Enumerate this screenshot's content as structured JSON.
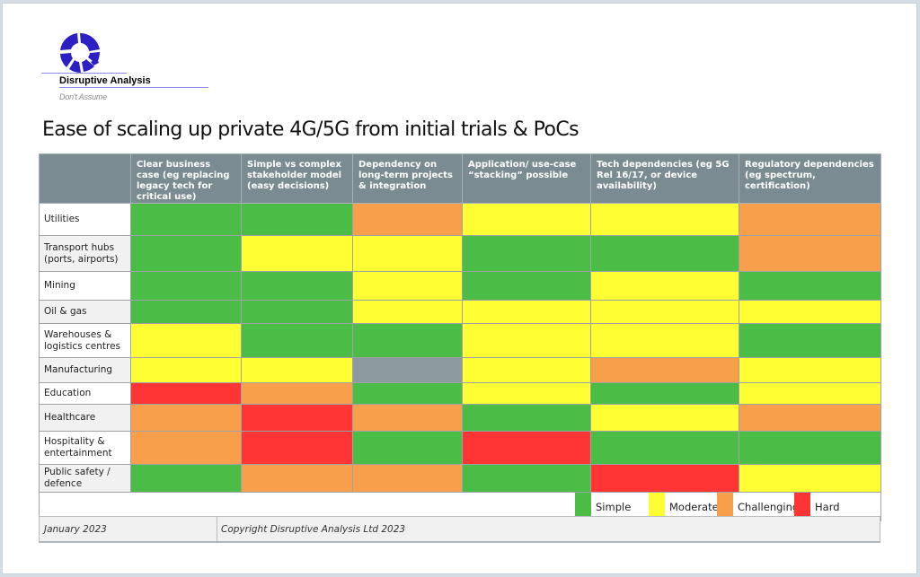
{
  "brand": {
    "name": "Disruptive Analysis",
    "tagline": "Don't Assume",
    "logo_icon": "segmented-ring-logo",
    "logo_color": "#2c1fc4"
  },
  "title": "Ease of scaling up private 4G/5G from initial trials & PoCs",
  "legend": [
    {
      "key": "simple",
      "label": "Simple",
      "color": "#4bbd46"
    },
    {
      "key": "moderate",
      "label": "Moderate",
      "color": "#ffff33"
    },
    {
      "key": "challenging",
      "label": "Challenging",
      "color": "#f79f4a"
    },
    {
      "key": "hard",
      "label": "Hard",
      "color": "#ff3434"
    }
  ],
  "na_color": "#8c9a9f",
  "columns": [
    "Clear business case (eg replacing legacy tech for critical use)",
    "Simple vs complex stakeholder model (easy decisions)",
    "Dependency on long-term projects & integration",
    "Application/ use-case “stacking” possible",
    "Tech dependencies (eg 5G Rel 16/17, or device availability)",
    "Regulatory dependencies (eg spectrum, certification)"
  ],
  "rows": [
    {
      "label": "Utilities",
      "ratings": [
        "simple",
        "simple",
        "challenging",
        "moderate",
        "moderate",
        "challenging"
      ]
    },
    {
      "label": "Transport hubs (ports, airports)",
      "ratings": [
        "simple",
        "moderate",
        "moderate",
        "simple",
        "simple",
        "challenging"
      ]
    },
    {
      "label": "Mining",
      "ratings": [
        "simple",
        "simple",
        "moderate",
        "simple",
        "moderate",
        "simple"
      ]
    },
    {
      "label": "Oil & gas",
      "ratings": [
        "simple",
        "simple",
        "moderate",
        "moderate",
        "moderate",
        "moderate"
      ]
    },
    {
      "label": "Warehouses & logistics centres",
      "ratings": [
        "moderate",
        "simple",
        "simple",
        "moderate",
        "moderate",
        "simple"
      ]
    },
    {
      "label": "Manufacturing",
      "ratings": [
        "moderate",
        "moderate",
        "na",
        "moderate",
        "challenging",
        "moderate"
      ]
    },
    {
      "label": "Education",
      "ratings": [
        "hard",
        "challenging",
        "simple",
        "moderate",
        "simple",
        "moderate"
      ]
    },
    {
      "label": "Healthcare",
      "ratings": [
        "challenging",
        "hard",
        "challenging",
        "simple",
        "moderate",
        "challenging"
      ]
    },
    {
      "label": "Hospitality & entertainment",
      "ratings": [
        "challenging",
        "hard",
        "simple",
        "hard",
        "simple",
        "simple"
      ]
    },
    {
      "label": "Public safety / defence",
      "ratings": [
        "simple",
        "challenging",
        "challenging",
        "simple",
        "hard",
        "moderate"
      ]
    }
  ],
  "footer": {
    "date": "January 2023",
    "copyright": "Copyright Disruptive Analysis Ltd 2023"
  }
}
